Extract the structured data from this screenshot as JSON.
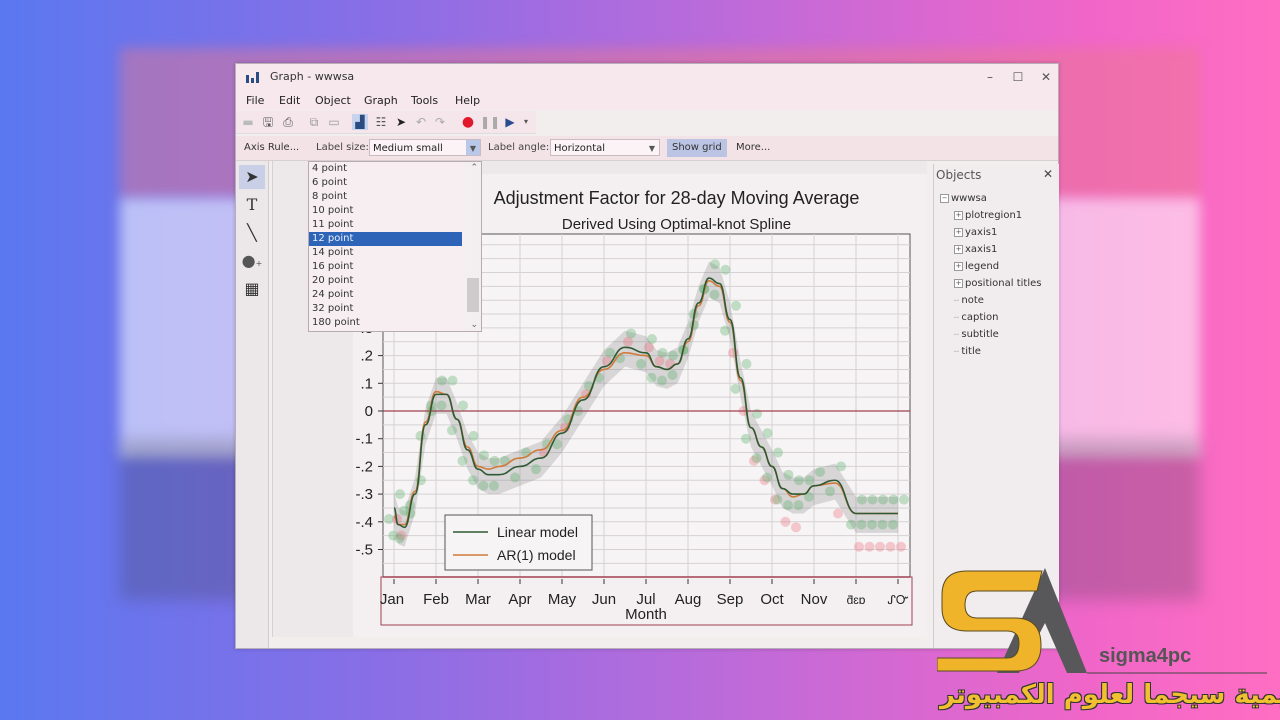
{
  "window": {
    "title": "Graph - wwwsa",
    "controls": {
      "minimize": "–",
      "maximize": "☐",
      "close": "✕"
    }
  },
  "menubar": [
    "File",
    "Edit",
    "Object",
    "Graph",
    "Tools",
    "Help"
  ],
  "toolbar": {
    "icons": [
      "open-icon",
      "save-icon",
      "print-icon",
      "copy-icon",
      "rename-icon",
      "graph-editor-icon",
      "data-editor-icon",
      "pointer-icon",
      "undo-icon",
      "redo-icon",
      "record-icon",
      "pause-icon",
      "play-icon"
    ]
  },
  "propbar": {
    "axis_rule": "Axis Rule...",
    "label_size_label": "Label size:",
    "label_size_value": "Medium small",
    "label_angle_label": "Label angle:",
    "label_angle_value": "Horizontal",
    "show_grid": "Show grid",
    "more": "More..."
  },
  "label_size_options": [
    "4 point",
    "6 point",
    "8 point",
    "10 point",
    "11 point",
    "12 point",
    "14 point",
    "16 point",
    "20 point",
    "24 point",
    "32 point",
    "180 point"
  ],
  "label_size_selected": "12 point",
  "left_tools": [
    "pointer-tool",
    "text-tool",
    "line-tool",
    "marker-tool",
    "grid-tool"
  ],
  "objects_panel": {
    "title": "Objects",
    "root": "wwwsa",
    "children": [
      {
        "label": "plotregion1",
        "expandable": true
      },
      {
        "label": "yaxis1",
        "expandable": true
      },
      {
        "label": "xaxis1",
        "expandable": true
      },
      {
        "label": "legend",
        "expandable": true
      },
      {
        "label": "positional titles",
        "expandable": true
      },
      {
        "label": "note",
        "expandable": false
      },
      {
        "label": "caption",
        "expandable": false
      },
      {
        "label": "subtitle",
        "expandable": false
      },
      {
        "label": "title",
        "expandable": false
      }
    ]
  },
  "chart_data": {
    "type": "line",
    "title": "Adjustment Factor for 28-day Moving Average",
    "subtitle": "Derived Using Optimal-knot Spline",
    "xlabel": "Month",
    "ylabel": "",
    "x_tick_labels": [
      "Jan",
      "Feb",
      "Mar",
      "Apr",
      "May",
      "Jun",
      "Jul",
      "Aug",
      "Sep",
      "Oct",
      "Nov",
      "ƌɛɒ",
      "ᔑᏅ"
    ],
    "y_tick_labels": [
      ".3",
      ".2",
      ".1",
      "0",
      "-.1",
      "-.2",
      "-.3",
      "-.4",
      "-.5"
    ],
    "y_ticks": [
      0.3,
      0.2,
      0.1,
      0,
      -0.1,
      -0.2,
      -0.3,
      -0.4,
      -0.5
    ],
    "ylim": [
      -0.6,
      0.65
    ],
    "xlim": [
      0,
      12.2
    ],
    "grid": true,
    "reference_line": 0,
    "legend": {
      "position": "bottom-left",
      "entries": [
        "Linear model",
        "AR(1) model"
      ]
    },
    "series": [
      {
        "name": "Linear model",
        "color": "#2f5a34",
        "x": [
          0,
          0.1,
          0.25,
          0.5,
          0.75,
          1.0,
          1.25,
          1.5,
          1.75,
          2.0,
          2.25,
          2.5,
          3.0,
          3.5,
          4.0,
          4.5,
          5.0,
          5.5,
          6.0,
          6.25,
          6.5,
          6.75,
          7.0,
          7.25,
          7.5,
          7.75,
          8.0,
          8.25,
          8.5,
          8.75,
          9.0,
          9.25,
          9.5,
          9.75,
          10.0,
          10.5,
          11.0,
          11.25,
          11.5,
          11.75,
          12.0
        ],
        "y": [
          -0.35,
          -0.41,
          -0.42,
          -0.3,
          -0.05,
          0.06,
          0.06,
          -0.03,
          -0.14,
          -0.21,
          -0.23,
          -0.23,
          -0.2,
          -0.17,
          -0.08,
          0.04,
          0.16,
          0.23,
          0.21,
          0.16,
          0.15,
          0.17,
          0.26,
          0.39,
          0.48,
          0.46,
          0.33,
          0.12,
          -0.06,
          -0.13,
          -0.2,
          -0.28,
          -0.3,
          -0.3,
          -0.27,
          -0.25,
          -0.37,
          -0.37,
          -0.37,
          -0.37,
          -0.37
        ]
      },
      {
        "name": "AR(1) model",
        "color": "#d07a3a",
        "x": [
          0,
          0.1,
          0.25,
          0.5,
          0.75,
          1.0,
          1.25,
          1.5,
          1.75,
          2.0,
          2.25,
          2.5,
          3.0,
          3.5,
          4.0,
          4.5,
          5.0,
          5.5,
          6.0,
          6.25,
          6.5,
          6.75,
          7.0,
          7.25,
          7.5,
          7.75,
          8.0,
          8.25,
          8.5,
          8.75,
          9.0,
          9.25,
          9.5,
          9.75,
          10.0,
          10.5,
          11.0,
          11.25,
          11.5,
          11.75,
          12.0
        ],
        "y": [
          -0.38,
          -0.41,
          -0.41,
          -0.29,
          -0.04,
          0.07,
          0.06,
          -0.03,
          -0.13,
          -0.2,
          -0.21,
          -0.2,
          -0.17,
          -0.14,
          -0.07,
          0.05,
          0.15,
          0.21,
          0.2,
          0.16,
          0.15,
          0.17,
          0.25,
          0.38,
          0.47,
          0.45,
          0.32,
          0.11,
          -0.06,
          -0.13,
          -0.2,
          -0.28,
          -0.31,
          -0.3,
          -0.27,
          -0.26,
          -0.37,
          -0.37,
          -0.37,
          -0.37,
          -0.37
        ]
      }
    ],
    "scatter_clouds": [
      {
        "name": "observed-green",
        "color": "#58b06a"
      },
      {
        "name": "observed-red",
        "color": "#e8707a"
      }
    ]
  },
  "branding": {
    "logo_text": "sigma4pc",
    "arabic_text": "اكاديمية سيجما لعلوم الكمبيوتر"
  }
}
